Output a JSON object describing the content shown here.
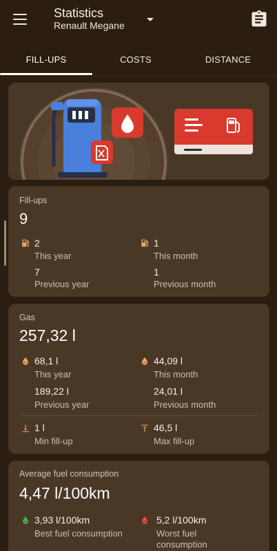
{
  "appbar": {
    "title": "Statistics",
    "subtitle": "Renault Megane",
    "menu_icon": "menu-icon",
    "dropdown_icon": "arrow-drop-down-icon",
    "report_icon": "clipboard-icon"
  },
  "tabs": [
    {
      "label": "FILL-UPS",
      "active": true
    },
    {
      "label": "COSTS",
      "active": false
    },
    {
      "label": "DISTANCE",
      "active": false
    }
  ],
  "fillups": {
    "label": "Fill-ups",
    "value": "9",
    "this_year": {
      "value": "2",
      "label": "This year"
    },
    "this_month": {
      "value": "1",
      "label": "This month"
    },
    "previous_year": {
      "value": "7",
      "label": "Previous year"
    },
    "previous_month": {
      "value": "1",
      "label": "Previous month"
    }
  },
  "gas": {
    "label": "Gas",
    "value": "257,32 l",
    "this_year": {
      "value": "68,1 l",
      "label": "This year"
    },
    "this_month": {
      "value": "44,09 l",
      "label": "This month"
    },
    "previous_year": {
      "value": "189,22 l",
      "label": "Previous year"
    },
    "previous_month": {
      "value": "24,01 l",
      "label": "Previous month"
    },
    "min": {
      "value": "1 l",
      "label": "Min fill-up"
    },
    "max": {
      "value": "46,5 l",
      "label": "Max fill-up"
    }
  },
  "consumption": {
    "label": "Average fuel consumption",
    "value": "4,47 l/100km",
    "best": {
      "value": "3,93 l/100km",
      "label": "Best fuel consumption"
    },
    "worst": {
      "value": "5,2 l/100km",
      "label": "Worst fuel consumption"
    }
  },
  "colors": {
    "background": "#2b1d10",
    "card": "#4a3826",
    "accent_orange": "#e8a86a",
    "pump_blue": "#4a7fdc",
    "red": "#d83a2e",
    "best_green": "#4caf50",
    "worst_red": "#e8513e"
  }
}
